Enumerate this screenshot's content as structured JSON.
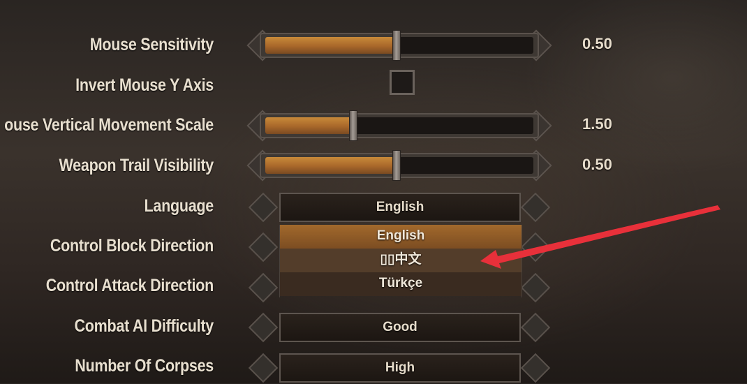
{
  "settings": {
    "mouse_sensitivity": {
      "label": "Mouse Sensitivity",
      "value": "0.50",
      "fraction": 0.49
    },
    "invert_mouse_y": {
      "label": "Invert Mouse Y Axis",
      "checked": false
    },
    "mouse_vertical_scale": {
      "label": "ouse Vertical Movement Scale",
      "value": "1.50",
      "fraction": 0.33
    },
    "weapon_trail": {
      "label": "Weapon Trail Visibility",
      "value": "0.50",
      "fraction": 0.49
    },
    "language": {
      "label": "Language",
      "value": "English",
      "options": [
        "English",
        "▯▯中文",
        "Türkçe"
      ]
    },
    "control_block": {
      "label": "Control Block Direction"
    },
    "control_attack": {
      "label": "Control Attack Direction"
    },
    "combat_ai": {
      "label": "Combat AI Difficulty",
      "value": "Good"
    },
    "corpses": {
      "label": "Number Of Corpses",
      "value": "High"
    }
  },
  "colors": {
    "accent": "#c88a3a",
    "annotation_arrow": "#e8303a"
  },
  "icons": [
    "chevron-left-icon",
    "chevron-right-icon",
    "annotation-arrow-icon"
  ]
}
